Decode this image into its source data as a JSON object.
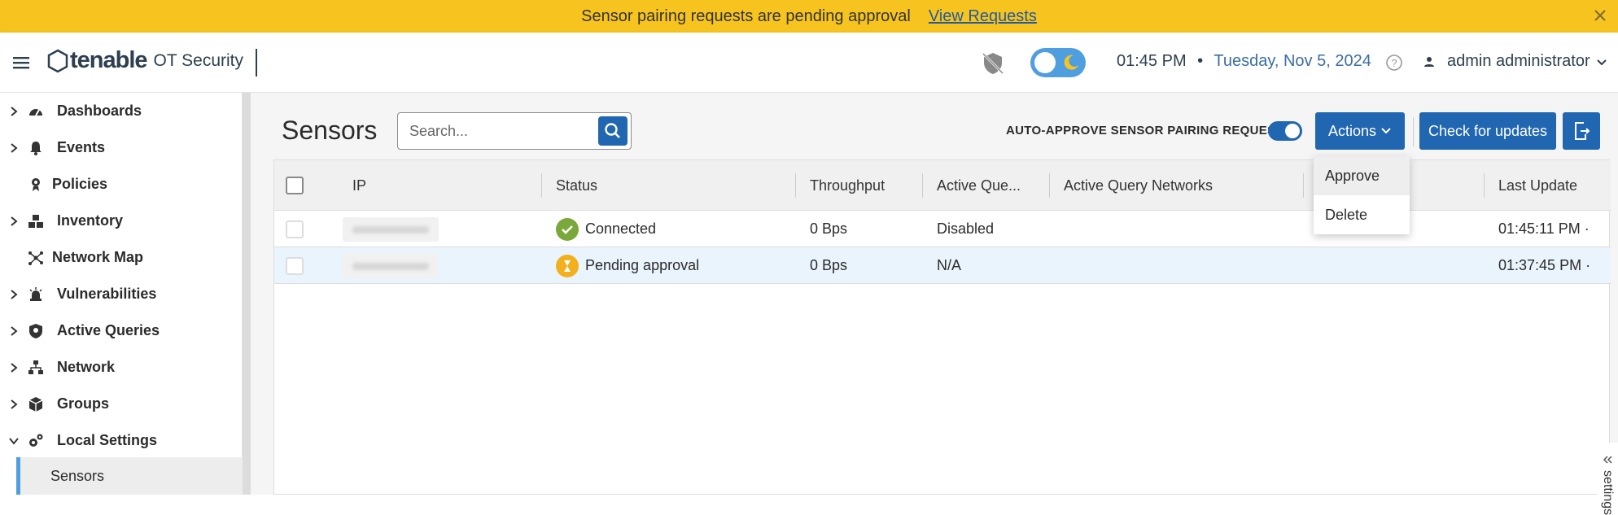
{
  "banner": {
    "message": "Sensor pairing requests are pending approval",
    "link": "View Requests",
    "color": "#f7c41f"
  },
  "header": {
    "brand": "tenable",
    "product": "OT Security",
    "time": "01:45 PM",
    "separator": "•",
    "date": "Tuesday, Nov 5, 2024",
    "user": "admin administrator",
    "icons": [
      "menu-icon",
      "shield-off-icon",
      "theme-toggle",
      "help-icon",
      "user-icon",
      "chevron-down-icon"
    ]
  },
  "sidebar": {
    "items": [
      {
        "label": "Dashboards",
        "icon": "gauge-icon",
        "expandable": true
      },
      {
        "label": "Events",
        "icon": "bell-icon",
        "expandable": true
      },
      {
        "label": "Policies",
        "icon": "policy-icon",
        "expandable": false
      },
      {
        "label": "Inventory",
        "icon": "inventory-icon",
        "expandable": true
      },
      {
        "label": "Network Map",
        "icon": "network-map-icon",
        "expandable": false
      },
      {
        "label": "Vulnerabilities",
        "icon": "alarm-icon",
        "expandable": true
      },
      {
        "label": "Active Queries",
        "icon": "shield-icon",
        "expandable": true
      },
      {
        "label": "Network",
        "icon": "network-icon",
        "expandable": true
      },
      {
        "label": "Groups",
        "icon": "groups-icon",
        "expandable": true
      },
      {
        "label": "Local Settings",
        "icon": "settings-icon",
        "expandable": true,
        "expanded": true
      }
    ],
    "sub_item": "Sensors"
  },
  "main": {
    "title": "Sensors",
    "search_placeholder": "Search...",
    "auto_approve_label": "AUTO-APPROVE SENSOR PAIRING REQUESTS",
    "auto_approve_on": true,
    "actions_label": "Actions",
    "check_updates_label": "Check for updates",
    "actions_menu": [
      "Approve",
      "Delete"
    ],
    "side_panel_label": "settings",
    "columns": [
      "IP",
      "Status",
      "Throughput",
      "Active Que...",
      "Active Query Networks",
      "",
      "Last Update"
    ],
    "rows": [
      {
        "ip": "",
        "status": "Connected",
        "status_type": "connected",
        "throughput": "0 Bps",
        "active_queries": "Disabled",
        "networks": "",
        "last_update": "01:45:11 PM ·"
      },
      {
        "ip": "",
        "status": "Pending approval",
        "status_type": "pending",
        "throughput": "0 Bps",
        "active_queries": "N/A",
        "networks": "",
        "last_update": "01:37:45 PM ·"
      }
    ]
  },
  "colors": {
    "primary": "#2166b0",
    "connected": "#7aa83a",
    "pending": "#f2b01e",
    "selected_row": "#eaf4fc"
  }
}
